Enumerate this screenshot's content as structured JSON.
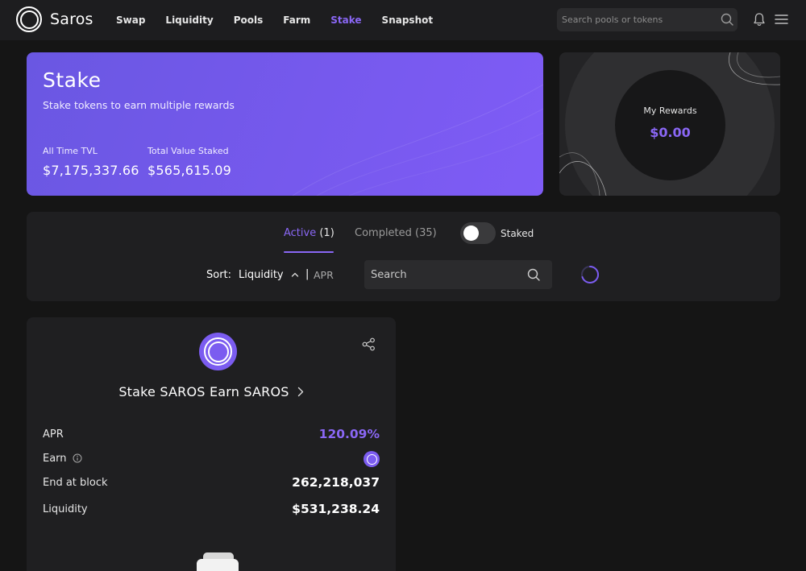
{
  "app": {
    "name": "Saros"
  },
  "nav": {
    "items": [
      {
        "label": "Swap",
        "active": false
      },
      {
        "label": "Liquidity",
        "active": false
      },
      {
        "label": "Pools",
        "active": false
      },
      {
        "label": "Farm",
        "active": false
      },
      {
        "label": "Stake",
        "active": true
      },
      {
        "label": "Snapshot",
        "active": false
      }
    ],
    "search_placeholder": "Search pools or tokens",
    "icons": [
      "search-icon",
      "bell-icon",
      "menu-icon"
    ]
  },
  "hero": {
    "title": "Stake",
    "subtitle": "Stake tokens to earn multiple rewards",
    "stats": [
      {
        "label": "All Time TVL",
        "value": "$7,175,337.66"
      },
      {
        "label": "Total Value Staked",
        "value": "$565,615.09"
      }
    ]
  },
  "rewards": {
    "label": "My Rewards",
    "value": "$0.00"
  },
  "filters": {
    "tabs": {
      "active_label": "Active",
      "active_count": "(1)",
      "completed_label": "Completed (35)"
    },
    "toggle_label": "Staked",
    "toggle_on": false,
    "sort_label": "Sort:",
    "sort_value": "Liquidity",
    "sort_separator": "|",
    "sort_alt": "APR",
    "search_placeholder": "Search"
  },
  "pool": {
    "title": "Stake SAROS Earn SAROS",
    "rows": {
      "apr_label": "APR",
      "apr_value": "120.09%",
      "earn_label": "Earn",
      "end_label": "End at block",
      "end_value": "262,218,037",
      "liquidity_label": "Liquidity",
      "liquidity_value": "$531,238.24"
    }
  },
  "colors": {
    "accent": "#8a67f5",
    "background": "#151515",
    "panel": "#1f1f21",
    "navbar": "#1d1d1f",
    "hero_gradient_start": "#6a57e2",
    "hero_gradient_end": "#7f5cf6"
  }
}
